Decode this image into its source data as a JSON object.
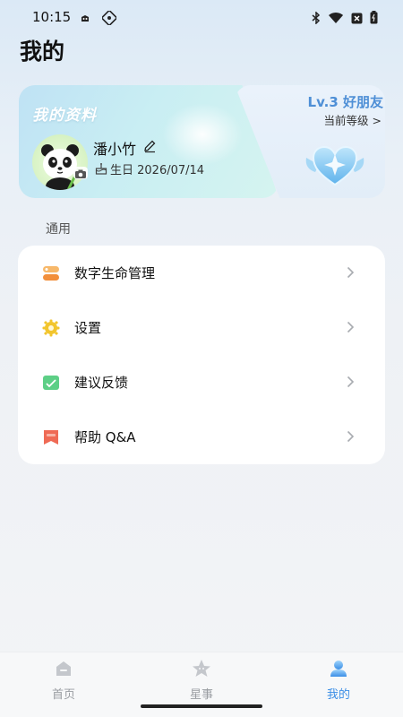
{
  "status_bar": {
    "time": "10:15",
    "icons": [
      "notification-icon",
      "app-icon",
      "bluetooth-icon",
      "wifi-icon",
      "no-sim-icon",
      "battery-icon"
    ]
  },
  "page": {
    "title": "我的"
  },
  "profile": {
    "card_title": "我的资料",
    "username": "潘小竹",
    "birthday": "生日 2026/07/14"
  },
  "level": {
    "title": "Lv.3 好朋友",
    "subtitle": "当前等级 >"
  },
  "section": {
    "label": "通用"
  },
  "menu": [
    {
      "label": "数字生命管理",
      "icon": "digital-life-icon",
      "color": "#f5a04a"
    },
    {
      "label": "设置",
      "icon": "settings-gear-icon",
      "color": "#f2c52d"
    },
    {
      "label": "建议反馈",
      "icon": "feedback-icon",
      "color": "#5dcf86"
    },
    {
      "label": "帮助 Q&A",
      "icon": "help-bookmark-icon",
      "color": "#ef6a55"
    }
  ],
  "bottom_nav": [
    {
      "label": "首页",
      "icon": "home-icon",
      "active": false
    },
    {
      "label": "星事",
      "icon": "star-icon",
      "active": false
    },
    {
      "label": "我的",
      "icon": "profile-icon",
      "active": true
    }
  ],
  "colors": {
    "accent": "#3b8ee6",
    "level_text": "#4e8fd6"
  }
}
